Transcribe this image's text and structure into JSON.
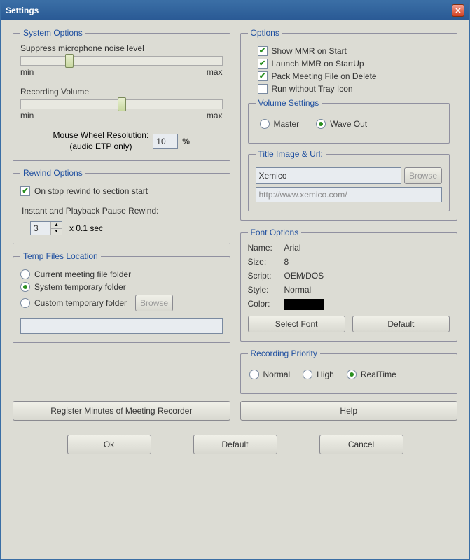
{
  "window": {
    "title": "Settings"
  },
  "systemOptions": {
    "legend": "System Options",
    "suppressLabel": "Suppress microphone noise level",
    "recVolLabel": "Recording Volume",
    "min": "min",
    "max": "max",
    "mwrLabel1": "Mouse Wheel Resolution:",
    "mwrLabel2": "(audio ETP only)",
    "mwrValue": "10",
    "percent": "%"
  },
  "rewind": {
    "legend": "Rewind Options",
    "onStop": "On stop rewind to section start",
    "onStopChecked": true,
    "instLabel": "Instant and Playback Pause Rewind:",
    "value": "3",
    "unit": "x 0.1 sec"
  },
  "temp": {
    "legend": "Temp Files Location",
    "opt1": "Current meeting file folder",
    "opt2": "System temporary folder",
    "opt3": "Custom temporary folder",
    "selected": 2,
    "browse": "Browse",
    "path": ""
  },
  "options": {
    "legend": "Options",
    "showMMR": {
      "label": "Show MMR on Start",
      "checked": true
    },
    "launchMMR": {
      "label": "Launch MMR on StartUp",
      "checked": true
    },
    "packFile": {
      "label": "Pack Meeting File on Delete",
      "checked": true
    },
    "noTray": {
      "label": "Run without Tray Icon",
      "checked": false
    },
    "volumeLegend": "Volume Settings",
    "volMaster": "Master",
    "volWave": "Wave Out",
    "volSelected": "wave",
    "titleLegend": "Title Image & Url:",
    "titleName": "Xemico",
    "browse": "Browse",
    "url": "http://www.xemico.com/"
  },
  "font": {
    "legend": "Font Options",
    "nameK": "Name:",
    "nameV": "Arial",
    "sizeK": "Size:",
    "sizeV": "8",
    "scriptK": "Script:",
    "scriptV": "OEM/DOS",
    "styleK": "Style:",
    "styleV": "Normal",
    "colorK": "Color:",
    "colorV": "#000000",
    "selectBtn": "Select Font",
    "defaultBtn": "Default"
  },
  "recPriority": {
    "legend": "Recording Priority",
    "normal": "Normal",
    "high": "High",
    "realtime": "RealTime",
    "selected": "realtime"
  },
  "midButtons": {
    "register": "Register Minutes of Meeting Recorder",
    "help": "Help"
  },
  "bottom": {
    "ok": "Ok",
    "def": "Default",
    "cancel": "Cancel"
  }
}
